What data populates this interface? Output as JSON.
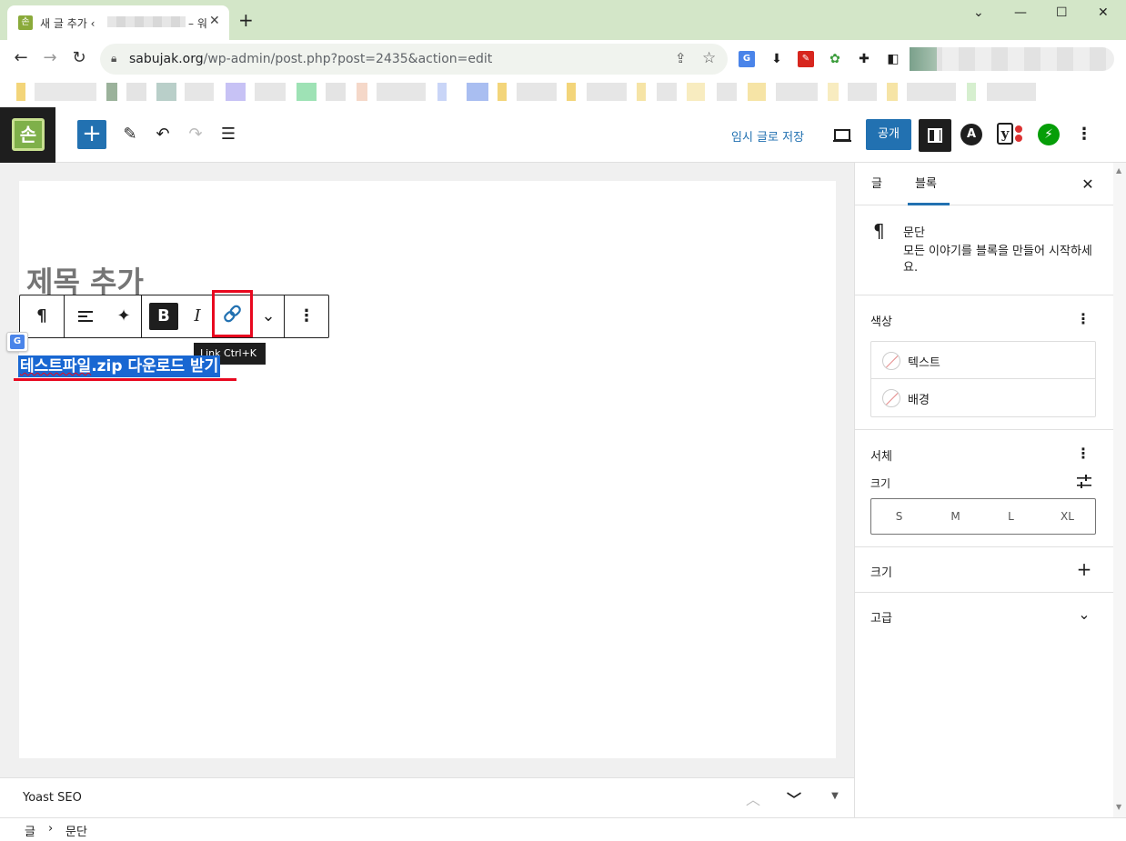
{
  "browser": {
    "tab_title": "새 글 추가 ‹",
    "tab_title_suffix": "– 워",
    "url_host": "sabujak.org",
    "url_path": "/wp-admin/post.php?post=2435&action=edit"
  },
  "wp_header": {
    "save_draft": "임시 글로 저장",
    "publish": "공개"
  },
  "editor": {
    "title_placeholder": "제목 추가",
    "paragraph_underlined": "테스트파일",
    "paragraph_rest": ".zip 다운로드 받기",
    "tooltip": "Link  Ctrl+K",
    "toolbar": {
      "paragraph_glyph": "¶",
      "bold_glyph": "B",
      "italic_glyph": "I"
    }
  },
  "yoast": {
    "label": "Yoast SEO"
  },
  "breadcrumb": {
    "root": "글",
    "sep": "›",
    "current": "문단"
  },
  "sidebar": {
    "tabs": [
      "글",
      "블록"
    ],
    "active_tab": "블록",
    "block_name": "문단",
    "block_desc": "모든 이야기를 블록을 만들어 시작하세요.",
    "color": {
      "heading": "색상",
      "text": "텍스트",
      "background": "배경"
    },
    "typography": {
      "heading": "서체",
      "size_label": "크기",
      "sizes": [
        "S",
        "M",
        "L",
        "XL"
      ]
    },
    "dimensions": {
      "heading": "크기"
    },
    "advanced": {
      "heading": "고급"
    }
  },
  "colors": {
    "accent": "#2271b1",
    "highlight_red": "#e8081f",
    "selection": "#1967d2"
  }
}
